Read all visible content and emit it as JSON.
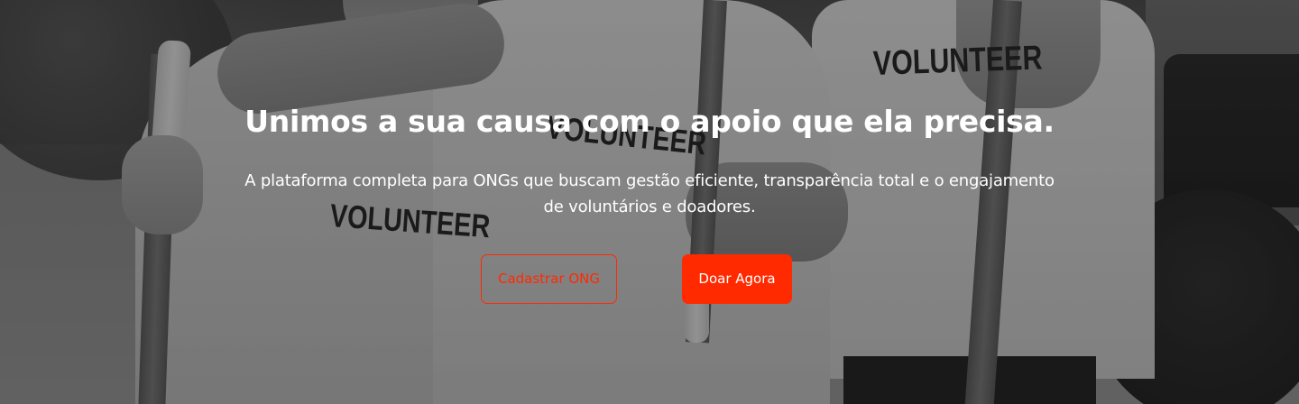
{
  "hero": {
    "headline": "Unimos a sua causa com o apoio que ela precisa.",
    "subtitle": "A plataforma completa para ONGs que buscam gestão eficiente, transparência total e o engajamento de voluntários e doadores.",
    "buttons": {
      "register_label": "Cadastrar ONG",
      "donate_label": "Doar Agora"
    },
    "background_photo": {
      "shirt_labels": [
        "VOLUNTEER",
        "VOLUNTEER",
        "VOLUNTEER"
      ]
    }
  },
  "colors": {
    "accent": "#ff2a00",
    "text_on_dark": "#ffffff",
    "overlay": "#141414"
  }
}
